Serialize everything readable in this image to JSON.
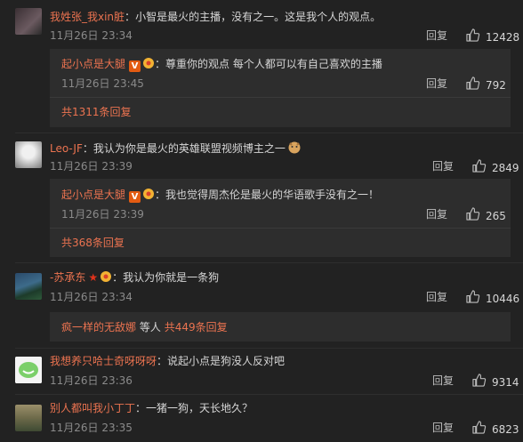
{
  "labels": {
    "reply": "回复",
    "colon": "："
  },
  "comments": [
    {
      "user": "我姓张_我xin脏",
      "text": "小智是最火的主播，没有之一。这是我个人的观点。",
      "time": "11月26日 23:34",
      "likes": "12428",
      "sub": {
        "user": "起小点是大腿",
        "text": "尊重你的观点 每个人都可以有自己喜欢的主播",
        "time": "11月26日 23:45",
        "likes": "792",
        "total": "共1311条回复"
      }
    },
    {
      "user": "Leo-JF",
      "text": "我认为你是最火的英雄联盟视频博主之一",
      "time": "11月26日 23:39",
      "likes": "2849",
      "sub": {
        "user": "起小点是大腿",
        "text": "我也觉得周杰伦是最火的华语歌手没有之一！",
        "time": "11月26日 23:39",
        "likes": "265",
        "total": "共368条回复"
      }
    },
    {
      "user": "-苏承东",
      "text": "我认为你就是一条狗",
      "time": "11月26日 23:34",
      "likes": "10446",
      "sub": {
        "user": "疯一样的无敌娜",
        "mid": "等人",
        "total": "共449条回复"
      }
    },
    {
      "user": "我想养只哈士奇呀呀呀",
      "text": "说起小点是狗没人反对吧",
      "time": "11月26日 23:36",
      "likes": "9314"
    },
    {
      "user": "别人都叫我小丁丁",
      "text": "一猪一狗，天长地久？",
      "time": "11月26日 23:35",
      "likes": "6823"
    }
  ],
  "colors": {
    "accent": "#eb7350",
    "bg": "#222222",
    "box": "#2d2d2d"
  }
}
